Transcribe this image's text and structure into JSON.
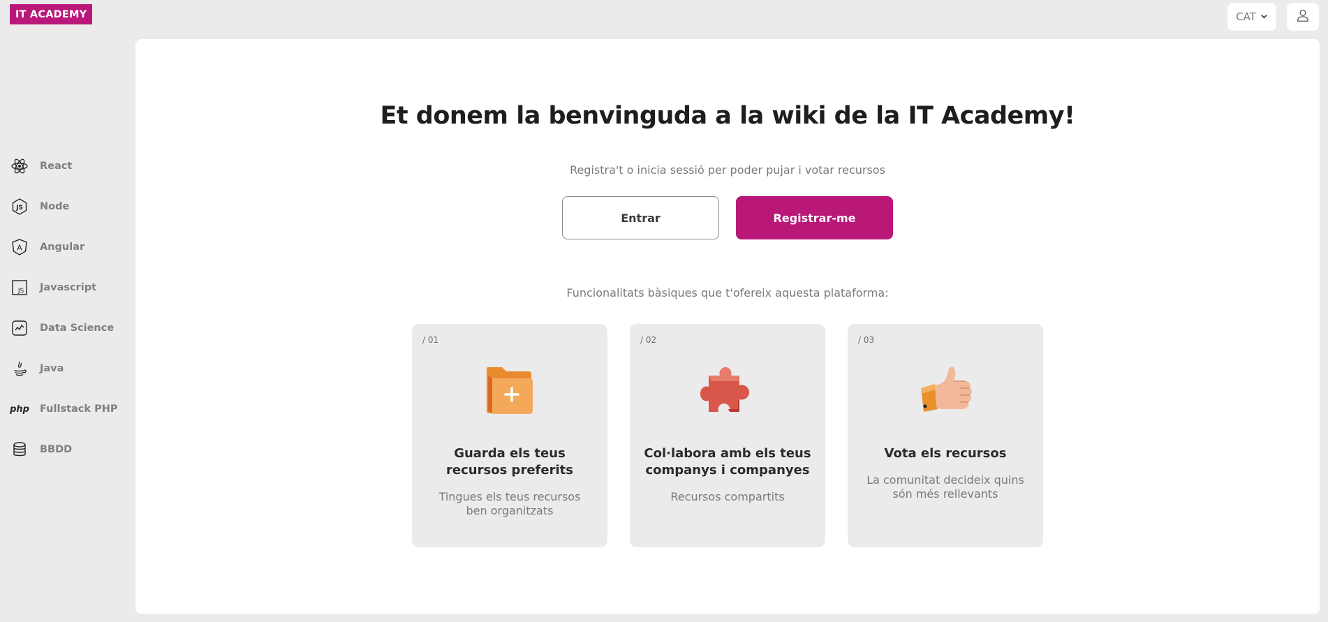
{
  "brand": {
    "logo_text": "IT ACADEMY",
    "accent_color": "#b91879"
  },
  "header": {
    "language": {
      "selected": "CAT",
      "icon": "chevron-down-icon"
    },
    "user_icon": "user-icon"
  },
  "sidebar": {
    "items": [
      {
        "label": "React",
        "icon": "react-icon"
      },
      {
        "label": "Node",
        "icon": "node-icon"
      },
      {
        "label": "Angular",
        "icon": "angular-icon"
      },
      {
        "label": "Javascript",
        "icon": "javascript-icon"
      },
      {
        "label": "Data Science",
        "icon": "data-science-icon"
      },
      {
        "label": "Java",
        "icon": "java-icon"
      },
      {
        "label": "Fullstack PHP",
        "icon": "php-icon",
        "icon_text": "php"
      },
      {
        "label": "BBDD",
        "icon": "database-icon"
      }
    ]
  },
  "main": {
    "title": "Et donem la benvinguda a la wiki de la IT Academy!",
    "subtitle": "Registra't o inicia sessió per poder pujar i votar recursos",
    "login_label": "Entrar",
    "register_label": "Registrar-me",
    "features_heading": "Funcionalitats bàsiques que t'ofereix aquesta plataforma:",
    "cards": [
      {
        "number": "/ 01",
        "title": "Guarda els teus recursos preferits",
        "description": "Tingues els teus recursos ben organitzats",
        "icon": "folder-icon"
      },
      {
        "number": "/ 02",
        "title": "Col·labora amb els teus companys i companyes",
        "description": "Recursos compartits",
        "icon": "puzzle-icon"
      },
      {
        "number": "/ 03",
        "title": "Vota els recursos",
        "description": "La comunitat decideix quins són més rellevants",
        "icon": "thumbs-up-icon"
      }
    ]
  }
}
